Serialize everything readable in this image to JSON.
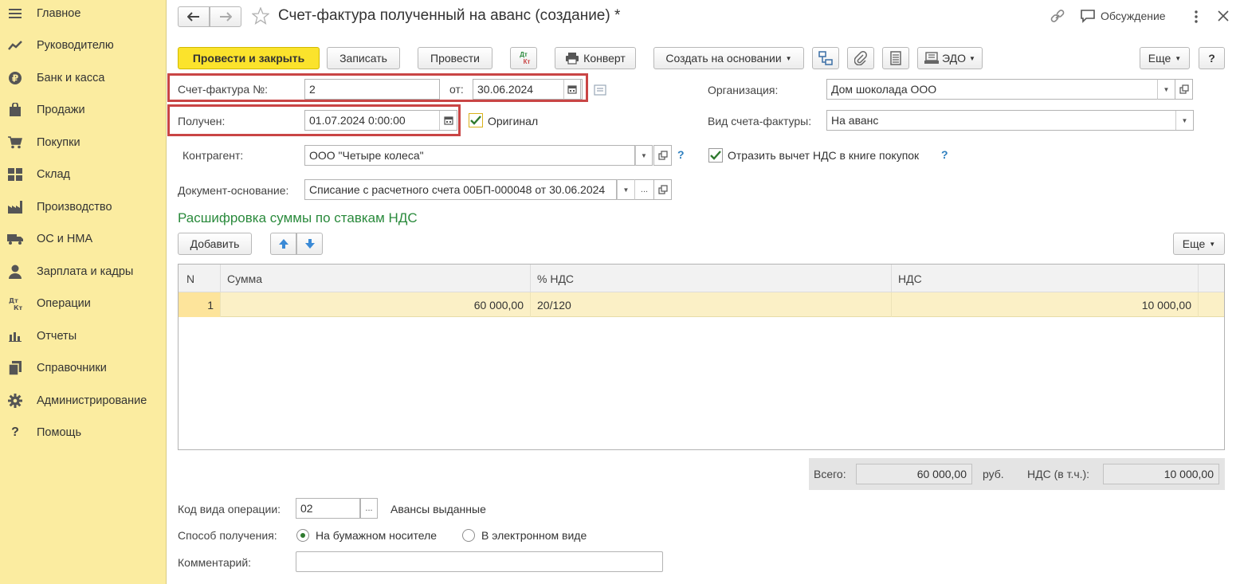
{
  "sidebar": {
    "items": [
      {
        "label": "Главное",
        "icon": "menu-icon"
      },
      {
        "label": "Руководителю",
        "icon": "trend-icon"
      },
      {
        "label": "Банк и касса",
        "icon": "ruble-icon"
      },
      {
        "label": "Продажи",
        "icon": "bag-icon"
      },
      {
        "label": "Покупки",
        "icon": "cart-icon"
      },
      {
        "label": "Склад",
        "icon": "warehouse-icon"
      },
      {
        "label": "Производство",
        "icon": "factory-icon"
      },
      {
        "label": "ОС и НМА",
        "icon": "truck-icon"
      },
      {
        "label": "Зарплата и кадры",
        "icon": "person-icon"
      },
      {
        "label": "Операции",
        "icon": "dt-kt-icon"
      },
      {
        "label": "Отчеты",
        "icon": "bar-chart-icon"
      },
      {
        "label": "Справочники",
        "icon": "books-icon"
      },
      {
        "label": "Администрирование",
        "icon": "gear-icon"
      },
      {
        "label": "Помощь",
        "icon": "question-icon"
      }
    ]
  },
  "header": {
    "title": "Счет-фактура полученный на аванс (создание) *",
    "discussion_label": "Обсуждение"
  },
  "toolbar": {
    "post_close": "Провести и закрыть",
    "save": "Записать",
    "post": "Провести",
    "dtkt_top": "Дт",
    "dtkt_bottom": "Кт",
    "envelope": "Конверт",
    "create_based": "Создать на основании",
    "edo": "ЭДО",
    "more": "Еще",
    "help": "?"
  },
  "form": {
    "invoice_no_label": "Счет-фактура №:",
    "invoice_no": "2",
    "from_label": "от:",
    "date": "30.06.2024",
    "received_label": "Получен:",
    "received": "01.07.2024  0:00:00",
    "original_label": "Оригинал",
    "original_checked": true,
    "org_label": "Организация:",
    "org": "Дом шоколада ООО",
    "invoice_kind_label": "Вид счета-фактуры:",
    "invoice_kind": "На аванс",
    "counterparty_label": "Контрагент:",
    "counterparty": "ООО \"Четыре колеса\"",
    "reflect_vat_label": "Отразить вычет НДС в книге покупок",
    "reflect_vat_checked": true,
    "base_doc_label": "Документ-основание:",
    "base_doc": "Списание с расчетного счета 00БП-000048 от 30.06.2024"
  },
  "vat_section": {
    "title": "Расшифровка суммы по ставкам НДС",
    "add_label": "Добавить",
    "more_label": "Еще",
    "columns": [
      "N",
      "Сумма",
      "% НДС",
      "НДС"
    ],
    "rows": [
      {
        "n": "1",
        "sum": "60 000,00",
        "rate": "20/120",
        "vat": "10 000,00"
      }
    ]
  },
  "totals": {
    "total_label": "Всего:",
    "total": "60 000,00",
    "currency": "руб.",
    "vat_label": "НДС (в т.ч.):",
    "vat": "10 000,00"
  },
  "footer": {
    "op_code_label": "Код вида операции:",
    "op_code": "02",
    "op_code_desc": "Авансы выданные",
    "receipt_label": "Способ получения:",
    "paper_label": "На бумажном носителе",
    "electronic_label": "В электронном виде",
    "selected": "paper",
    "comment_label": "Комментарий:",
    "comment": ""
  },
  "colors": {
    "sidebar_bg": "#fbeca0",
    "primary_button": "#fbe32c",
    "highlight_frame": "#c94545",
    "section_title": "#2a8a3c",
    "selected_row": "#fbf0c6"
  }
}
